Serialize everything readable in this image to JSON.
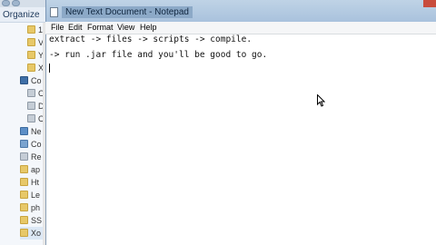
{
  "explorer": {
    "organize_label": "Organize",
    "tree_items": [
      {
        "label": "1",
        "icon": "folder-icon"
      },
      {
        "label": "V",
        "icon": "folder-icon"
      },
      {
        "label": "Y",
        "icon": "folder-icon"
      },
      {
        "label": "X",
        "icon": "folder-icon"
      },
      {
        "label": "Co",
        "icon": "computer-icon"
      },
      {
        "label": "C",
        "icon": "drive-icon"
      },
      {
        "label": "D",
        "icon": "drive-icon"
      },
      {
        "label": "C",
        "icon": "drive-icon"
      },
      {
        "label": "Ne",
        "icon": "network-icon"
      },
      {
        "label": "Co",
        "icon": "control-panel-icon"
      },
      {
        "label": "Re",
        "icon": "recycle-bin-icon"
      },
      {
        "label": "ap",
        "icon": "folder-icon"
      },
      {
        "label": "Ht",
        "icon": "folder-icon"
      },
      {
        "label": "Le",
        "icon": "folder-icon"
      },
      {
        "label": "ph",
        "icon": "folder-icon"
      },
      {
        "label": "SS",
        "icon": "folder-icon"
      },
      {
        "label": "Xo",
        "icon": "folder-icon"
      }
    ]
  },
  "notepad": {
    "title": "New Text Document - Notepad",
    "menu": [
      "File",
      "Edit",
      "Format",
      "View",
      "Help"
    ],
    "lines": [
      "extract -> files -> scripts -> compile.",
      "-> run .jar file and you'll be good to go."
    ]
  }
}
